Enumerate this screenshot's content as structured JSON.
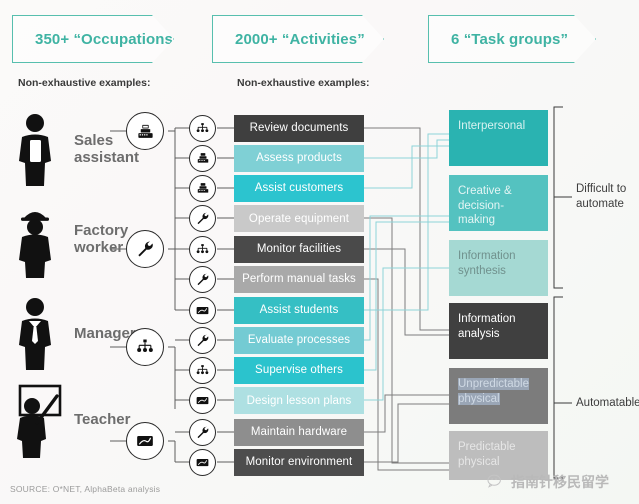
{
  "headers": [
    {
      "id": "occupations",
      "label": "350+ “Occupations”"
    },
    {
      "id": "activities",
      "label": "2000+ “Activities”"
    },
    {
      "id": "taskgroups",
      "label": "6 “Task groups”"
    }
  ],
  "subnotes": {
    "occupations": "Non-exhaustive examples:",
    "activities": "Non-exhaustive examples:"
  },
  "occupations": [
    {
      "name": "Sales\nassistant",
      "label": "Sales assistant",
      "icon": "cash-register-icon",
      "figure": "apron-person-icon"
    },
    {
      "name": "Factory\nworker",
      "label": "Factory worker",
      "icon": "wrench-icon",
      "figure": "hardhat-person-icon"
    },
    {
      "name": "Manager",
      "label": "Manager",
      "icon": "org-chart-icon",
      "figure": "necktie-person-icon"
    },
    {
      "name": "Teacher",
      "label": "Teacher",
      "icon": "blackboard-icon",
      "figure": "pointer-person-icon"
    }
  ],
  "activities": [
    {
      "label": "Review documents",
      "icon": "org-chart-icon",
      "color": "#3f3f3f",
      "textColor": "#ffffff"
    },
    {
      "label": "Assess products",
      "icon": "cash-register-icon",
      "color": "#7fd0d5",
      "textColor": "#ffffff"
    },
    {
      "label": "Assist customers",
      "icon": "cash-register-icon",
      "color": "#2cc4cf",
      "textColor": "#ffffff"
    },
    {
      "label": "Operate equipment",
      "icon": "wrench-icon",
      "color": "#c9c9c9",
      "textColor": "#ffffff"
    },
    {
      "label": "Monitor facilities",
      "icon": "org-chart-icon",
      "color": "#4a4a4a",
      "textColor": "#ffffff"
    },
    {
      "label": "Perform manual tasks",
      "icon": "wrench-icon",
      "color": "#a9a9a9",
      "textColor": "#ffffff"
    },
    {
      "label": "Assist students",
      "icon": "blackboard-icon",
      "color": "#35bfc4",
      "textColor": "#ffffff"
    },
    {
      "label": "Evaluate processes",
      "icon": "wrench-icon",
      "color": "#74cbd3",
      "textColor": "#ffffff"
    },
    {
      "label": "Supervise others",
      "icon": "org-chart-icon",
      "color": "#2bc3cd",
      "textColor": "#ffffff"
    },
    {
      "label": "Design lesson plans",
      "icon": "blackboard-icon",
      "color": "#aee0e2",
      "textColor": "#ffffff"
    },
    {
      "label": "Maintain hardware",
      "icon": "wrench-icon",
      "color": "#8e8e8e",
      "textColor": "#ffffff"
    },
    {
      "label": "Monitor environment",
      "icon": "blackboard-icon",
      "color": "#4d4d4d",
      "textColor": "#ffffff"
    }
  ],
  "task_groups": [
    {
      "label": "Interpersonal",
      "color": "#2ab3b1",
      "textColor": "#d8f2f0",
      "group": "difficult"
    },
    {
      "label": "Creative &\ndecision-making",
      "color": "#54c2c0",
      "textColor": "#e3f5f4",
      "group": "difficult"
    },
    {
      "label": "Information\nsynthesis",
      "color": "#a5d9d3",
      "textColor": "#6f8f8c",
      "group": "difficult"
    },
    {
      "label": "Information\nanalysis",
      "color": "#404040",
      "textColor": "#ffffff",
      "group": "automatable"
    },
    {
      "label": "Unpredictable\nphysical",
      "color": "#7c7c7c",
      "textColor": "#cfd9e4",
      "group": "automatable",
      "selected": true
    },
    {
      "label": "Predictable\nphysical",
      "color": "#bdbdbd",
      "textColor": "#e4e4e4",
      "group": "automatable"
    }
  ],
  "brackets": [
    {
      "id": "difficult",
      "label": "Difficult to\nautomate"
    },
    {
      "id": "automatable",
      "label": "Automatable"
    }
  ],
  "source": "SOURCE: O*NET, AlphaBeta analysis",
  "watermark": {
    "text": "指南针移民留学",
    "icon": "wechat-icon"
  },
  "colors": {
    "accent_teal": "#3fb3a3",
    "banner_border": "#57bfae",
    "dark_bar": "#3f3f3f",
    "bright_teal": "#2cc4cf",
    "connector_dark": "#6a6a6a",
    "connector_teal": "#8fd6d8"
  }
}
